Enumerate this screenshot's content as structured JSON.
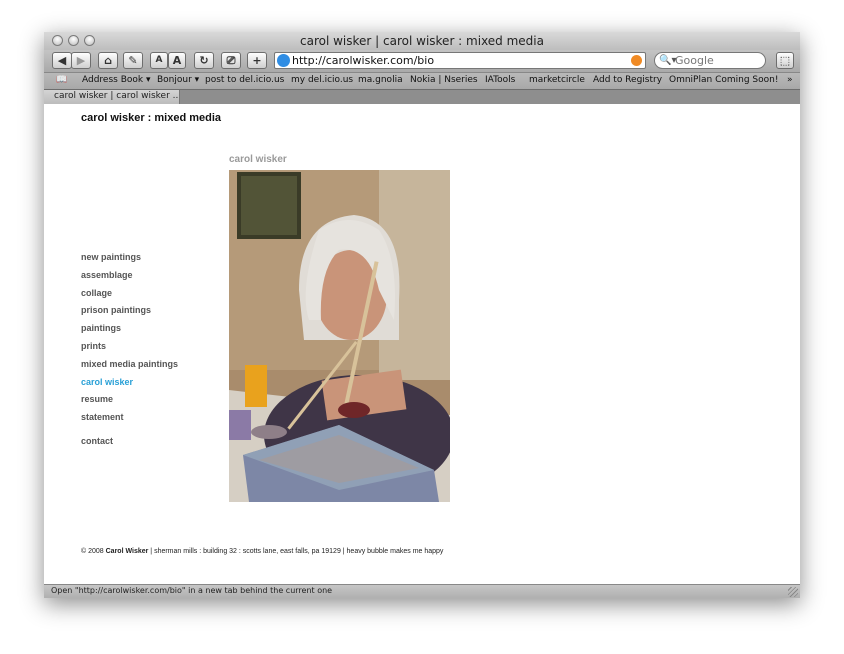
{
  "window": {
    "title": "carol wisker | carol wisker : mixed media"
  },
  "toolbar": {
    "back_icon": "back-arrow-icon",
    "forward_icon": "forward-arrow-icon",
    "home_icon": "home-icon",
    "edit_icon": "pencil-icon",
    "text_smaller": "A",
    "text_bigger": "A",
    "reload_icon": "reload-icon",
    "snapback_icon": "snapback-icon",
    "add_label": "+",
    "url": "http://carolwisker.com/bio",
    "search_placeholder": "Google",
    "bookmark_icon": "bookmark-icon"
  },
  "bookmarks": {
    "items": [
      "Address Book ▾",
      "Bonjour ▾",
      "post to del.icio.us",
      "my del.icio.us",
      "ma.gnolia",
      "Nokia | Nseries",
      "IATools",
      "marketcircle",
      "Add to Registry",
      "OmniPlan Coming Soon!"
    ],
    "overflow": "»"
  },
  "tab": {
    "label": "carol wisker | carol wisker ..."
  },
  "site": {
    "title": "carol wisker : mixed media",
    "section_heading": "carol wisker",
    "photo_alt": "carol wisker painting",
    "nav": [
      "new paintings",
      "assemblage",
      "collage",
      "prison paintings",
      "paintings",
      "prints",
      "mixed media paintings",
      "carol wisker",
      "resume",
      "statement"
    ],
    "nav_contact": "contact",
    "active_nav": "carol wisker",
    "active_color": "#29a0d6",
    "footer_prefix": "© 2008 ",
    "footer_name": "Carol Wisker",
    "footer_rest": " | sherman mills : building 32 : scotts lane, east falls, pa 19129 | heavy bubble makes me happy"
  },
  "status": {
    "text": "Open \"http://carolwisker.com/bio\" in a new tab behind the current one"
  }
}
